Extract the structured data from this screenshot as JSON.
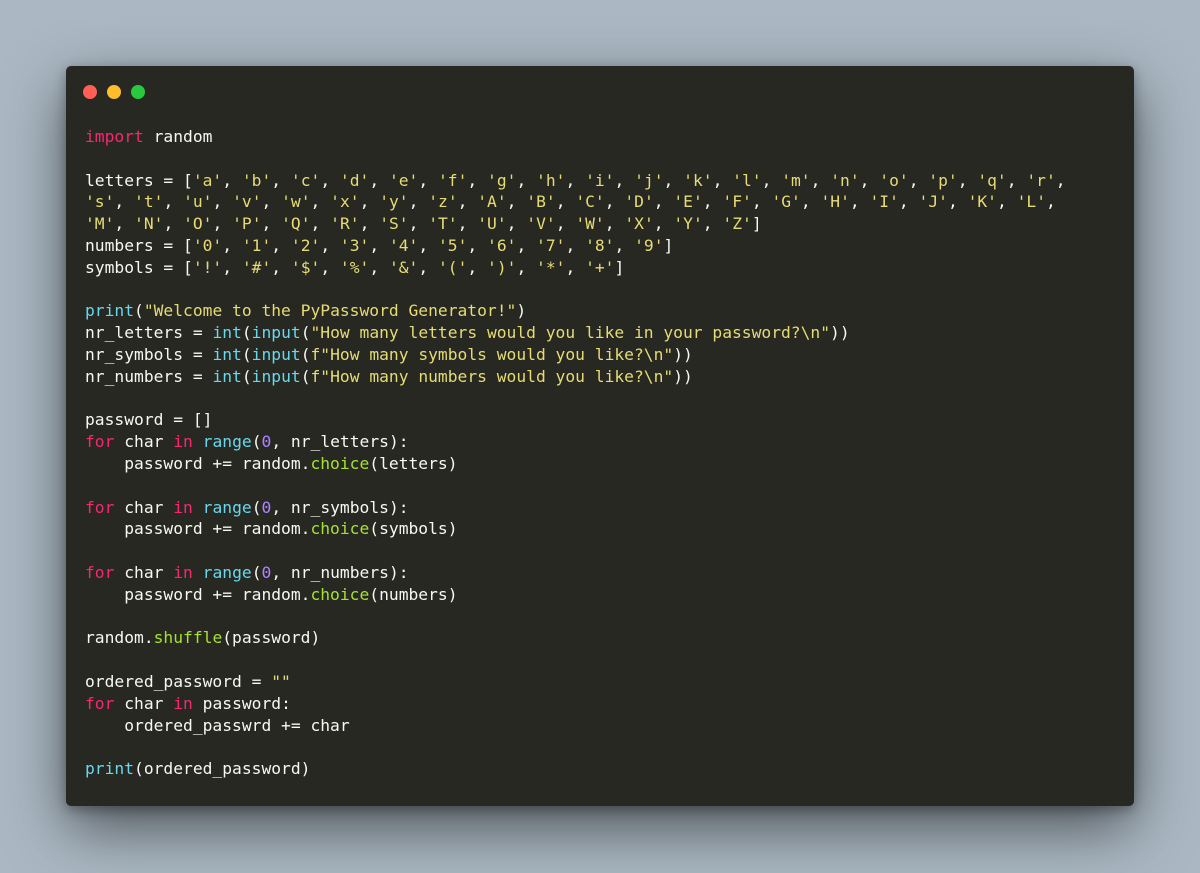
{
  "window": {
    "controls": [
      {
        "name": "close-button",
        "color": "#ff5f56"
      },
      {
        "name": "minimize-button",
        "color": "#ffbd2e"
      },
      {
        "name": "maximize-button",
        "color": "#27c93f"
      }
    ]
  },
  "colors": {
    "keyword": "#f92672",
    "string": "#e6db74",
    "builtin": "#66d9ef",
    "function": "#a6e22e",
    "number": "#ae81ff",
    "plain": "#f8f8f2",
    "background": "#272822"
  },
  "code": {
    "language": "python",
    "lines": [
      [
        [
          "kw",
          "import"
        ],
        [
          "plain",
          " random"
        ]
      ],
      [],
      [
        [
          "plain",
          "letters = ["
        ],
        [
          "str",
          "'a'"
        ],
        [
          "plain",
          ", "
        ],
        [
          "str",
          "'b'"
        ],
        [
          "plain",
          ", "
        ],
        [
          "str",
          "'c'"
        ],
        [
          "plain",
          ", "
        ],
        [
          "str",
          "'d'"
        ],
        [
          "plain",
          ", "
        ],
        [
          "str",
          "'e'"
        ],
        [
          "plain",
          ", "
        ],
        [
          "str",
          "'f'"
        ],
        [
          "plain",
          ", "
        ],
        [
          "str",
          "'g'"
        ],
        [
          "plain",
          ", "
        ],
        [
          "str",
          "'h'"
        ],
        [
          "plain",
          ", "
        ],
        [
          "str",
          "'i'"
        ],
        [
          "plain",
          ", "
        ],
        [
          "str",
          "'j'"
        ],
        [
          "plain",
          ", "
        ],
        [
          "str",
          "'k'"
        ],
        [
          "plain",
          ", "
        ],
        [
          "str",
          "'l'"
        ],
        [
          "plain",
          ", "
        ],
        [
          "str",
          "'m'"
        ],
        [
          "plain",
          ", "
        ],
        [
          "str",
          "'n'"
        ],
        [
          "plain",
          ", "
        ],
        [
          "str",
          "'o'"
        ],
        [
          "plain",
          ", "
        ],
        [
          "str",
          "'p'"
        ],
        [
          "plain",
          ", "
        ],
        [
          "str",
          "'q'"
        ],
        [
          "plain",
          ", "
        ],
        [
          "str",
          "'r'"
        ],
        [
          "plain",
          ","
        ]
      ],
      [
        [
          "str",
          "'s'"
        ],
        [
          "plain",
          ", "
        ],
        [
          "str",
          "'t'"
        ],
        [
          "plain",
          ", "
        ],
        [
          "str",
          "'u'"
        ],
        [
          "plain",
          ", "
        ],
        [
          "str",
          "'v'"
        ],
        [
          "plain",
          ", "
        ],
        [
          "str",
          "'w'"
        ],
        [
          "plain",
          ", "
        ],
        [
          "str",
          "'x'"
        ],
        [
          "plain",
          ", "
        ],
        [
          "str",
          "'y'"
        ],
        [
          "plain",
          ", "
        ],
        [
          "str",
          "'z'"
        ],
        [
          "plain",
          ", "
        ],
        [
          "str",
          "'A'"
        ],
        [
          "plain",
          ", "
        ],
        [
          "str",
          "'B'"
        ],
        [
          "plain",
          ", "
        ],
        [
          "str",
          "'C'"
        ],
        [
          "plain",
          ", "
        ],
        [
          "str",
          "'D'"
        ],
        [
          "plain",
          ", "
        ],
        [
          "str",
          "'E'"
        ],
        [
          "plain",
          ", "
        ],
        [
          "str",
          "'F'"
        ],
        [
          "plain",
          ", "
        ],
        [
          "str",
          "'G'"
        ],
        [
          "plain",
          ", "
        ],
        [
          "str",
          "'H'"
        ],
        [
          "plain",
          ", "
        ],
        [
          "str",
          "'I'"
        ],
        [
          "plain",
          ", "
        ],
        [
          "str",
          "'J'"
        ],
        [
          "plain",
          ", "
        ],
        [
          "str",
          "'K'"
        ],
        [
          "plain",
          ", "
        ],
        [
          "str",
          "'L'"
        ],
        [
          "plain",
          ","
        ]
      ],
      [
        [
          "str",
          "'M'"
        ],
        [
          "plain",
          ", "
        ],
        [
          "str",
          "'N'"
        ],
        [
          "plain",
          ", "
        ],
        [
          "str",
          "'O'"
        ],
        [
          "plain",
          ", "
        ],
        [
          "str",
          "'P'"
        ],
        [
          "plain",
          ", "
        ],
        [
          "str",
          "'Q'"
        ],
        [
          "plain",
          ", "
        ],
        [
          "str",
          "'R'"
        ],
        [
          "plain",
          ", "
        ],
        [
          "str",
          "'S'"
        ],
        [
          "plain",
          ", "
        ],
        [
          "str",
          "'T'"
        ],
        [
          "plain",
          ", "
        ],
        [
          "str",
          "'U'"
        ],
        [
          "plain",
          ", "
        ],
        [
          "str",
          "'V'"
        ],
        [
          "plain",
          ", "
        ],
        [
          "str",
          "'W'"
        ],
        [
          "plain",
          ", "
        ],
        [
          "str",
          "'X'"
        ],
        [
          "plain",
          ", "
        ],
        [
          "str",
          "'Y'"
        ],
        [
          "plain",
          ", "
        ],
        [
          "str",
          "'Z'"
        ],
        [
          "plain",
          "]"
        ]
      ],
      [
        [
          "plain",
          "numbers = ["
        ],
        [
          "str",
          "'0'"
        ],
        [
          "plain",
          ", "
        ],
        [
          "str",
          "'1'"
        ],
        [
          "plain",
          ", "
        ],
        [
          "str",
          "'2'"
        ],
        [
          "plain",
          ", "
        ],
        [
          "str",
          "'3'"
        ],
        [
          "plain",
          ", "
        ],
        [
          "str",
          "'4'"
        ],
        [
          "plain",
          ", "
        ],
        [
          "str",
          "'5'"
        ],
        [
          "plain",
          ", "
        ],
        [
          "str",
          "'6'"
        ],
        [
          "plain",
          ", "
        ],
        [
          "str",
          "'7'"
        ],
        [
          "plain",
          ", "
        ],
        [
          "str",
          "'8'"
        ],
        [
          "plain",
          ", "
        ],
        [
          "str",
          "'9'"
        ],
        [
          "plain",
          "]"
        ]
      ],
      [
        [
          "plain",
          "symbols = ["
        ],
        [
          "str",
          "'!'"
        ],
        [
          "plain",
          ", "
        ],
        [
          "str",
          "'#'"
        ],
        [
          "plain",
          ", "
        ],
        [
          "str",
          "'$'"
        ],
        [
          "plain",
          ", "
        ],
        [
          "str",
          "'%'"
        ],
        [
          "plain",
          ", "
        ],
        [
          "str",
          "'&'"
        ],
        [
          "plain",
          ", "
        ],
        [
          "str",
          "'('"
        ],
        [
          "plain",
          ", "
        ],
        [
          "str",
          "')'"
        ],
        [
          "plain",
          ", "
        ],
        [
          "str",
          "'*'"
        ],
        [
          "plain",
          ", "
        ],
        [
          "str",
          "'+'"
        ],
        [
          "plain",
          "]"
        ]
      ],
      [],
      [
        [
          "builtin",
          "print"
        ],
        [
          "plain",
          "("
        ],
        [
          "str",
          "\"Welcome to the PyPassword Generator!\""
        ],
        [
          "plain",
          ")"
        ]
      ],
      [
        [
          "plain",
          "nr_letters = "
        ],
        [
          "builtin",
          "int"
        ],
        [
          "plain",
          "("
        ],
        [
          "builtin",
          "input"
        ],
        [
          "plain",
          "("
        ],
        [
          "str",
          "\"How many letters would you like in your password?\\n\""
        ],
        [
          "plain",
          "))"
        ]
      ],
      [
        [
          "plain",
          "nr_symbols = "
        ],
        [
          "builtin",
          "int"
        ],
        [
          "plain",
          "("
        ],
        [
          "builtin",
          "input"
        ],
        [
          "plain",
          "("
        ],
        [
          "str",
          "f\"How many symbols would you like?\\n\""
        ],
        [
          "plain",
          "))"
        ]
      ],
      [
        [
          "plain",
          "nr_numbers = "
        ],
        [
          "builtin",
          "int"
        ],
        [
          "plain",
          "("
        ],
        [
          "builtin",
          "input"
        ],
        [
          "plain",
          "("
        ],
        [
          "str",
          "f\"How many numbers would you like?\\n\""
        ],
        [
          "plain",
          "))"
        ]
      ],
      [],
      [
        [
          "plain",
          "password = []"
        ]
      ],
      [
        [
          "kw",
          "for"
        ],
        [
          "plain",
          " char "
        ],
        [
          "kw",
          "in"
        ],
        [
          "plain",
          " "
        ],
        [
          "builtin",
          "range"
        ],
        [
          "plain",
          "("
        ],
        [
          "num",
          "0"
        ],
        [
          "plain",
          ", nr_letters):"
        ]
      ],
      [
        [
          "plain",
          "    password += random."
        ],
        [
          "fn",
          "choice"
        ],
        [
          "plain",
          "(letters)"
        ]
      ],
      [],
      [
        [
          "kw",
          "for"
        ],
        [
          "plain",
          " char "
        ],
        [
          "kw",
          "in"
        ],
        [
          "plain",
          " "
        ],
        [
          "builtin",
          "range"
        ],
        [
          "plain",
          "("
        ],
        [
          "num",
          "0"
        ],
        [
          "plain",
          ", nr_symbols):"
        ]
      ],
      [
        [
          "plain",
          "    password += random."
        ],
        [
          "fn",
          "choice"
        ],
        [
          "plain",
          "(symbols)"
        ]
      ],
      [],
      [
        [
          "kw",
          "for"
        ],
        [
          "plain",
          " char "
        ],
        [
          "kw",
          "in"
        ],
        [
          "plain",
          " "
        ],
        [
          "builtin",
          "range"
        ],
        [
          "plain",
          "("
        ],
        [
          "num",
          "0"
        ],
        [
          "plain",
          ", nr_numbers):"
        ]
      ],
      [
        [
          "plain",
          "    password += random."
        ],
        [
          "fn",
          "choice"
        ],
        [
          "plain",
          "(numbers)"
        ]
      ],
      [],
      [
        [
          "plain",
          "random."
        ],
        [
          "fn",
          "shuffle"
        ],
        [
          "plain",
          "(password)"
        ]
      ],
      [],
      [
        [
          "plain",
          "ordered_password = "
        ],
        [
          "str",
          "\"\""
        ]
      ],
      [
        [
          "kw",
          "for"
        ],
        [
          "plain",
          " char "
        ],
        [
          "kw",
          "in"
        ],
        [
          "plain",
          " password:"
        ]
      ],
      [
        [
          "plain",
          "    ordered_passwrd += char"
        ]
      ],
      [],
      [
        [
          "builtin",
          "print"
        ],
        [
          "plain",
          "(ordered_password)"
        ]
      ]
    ]
  }
}
